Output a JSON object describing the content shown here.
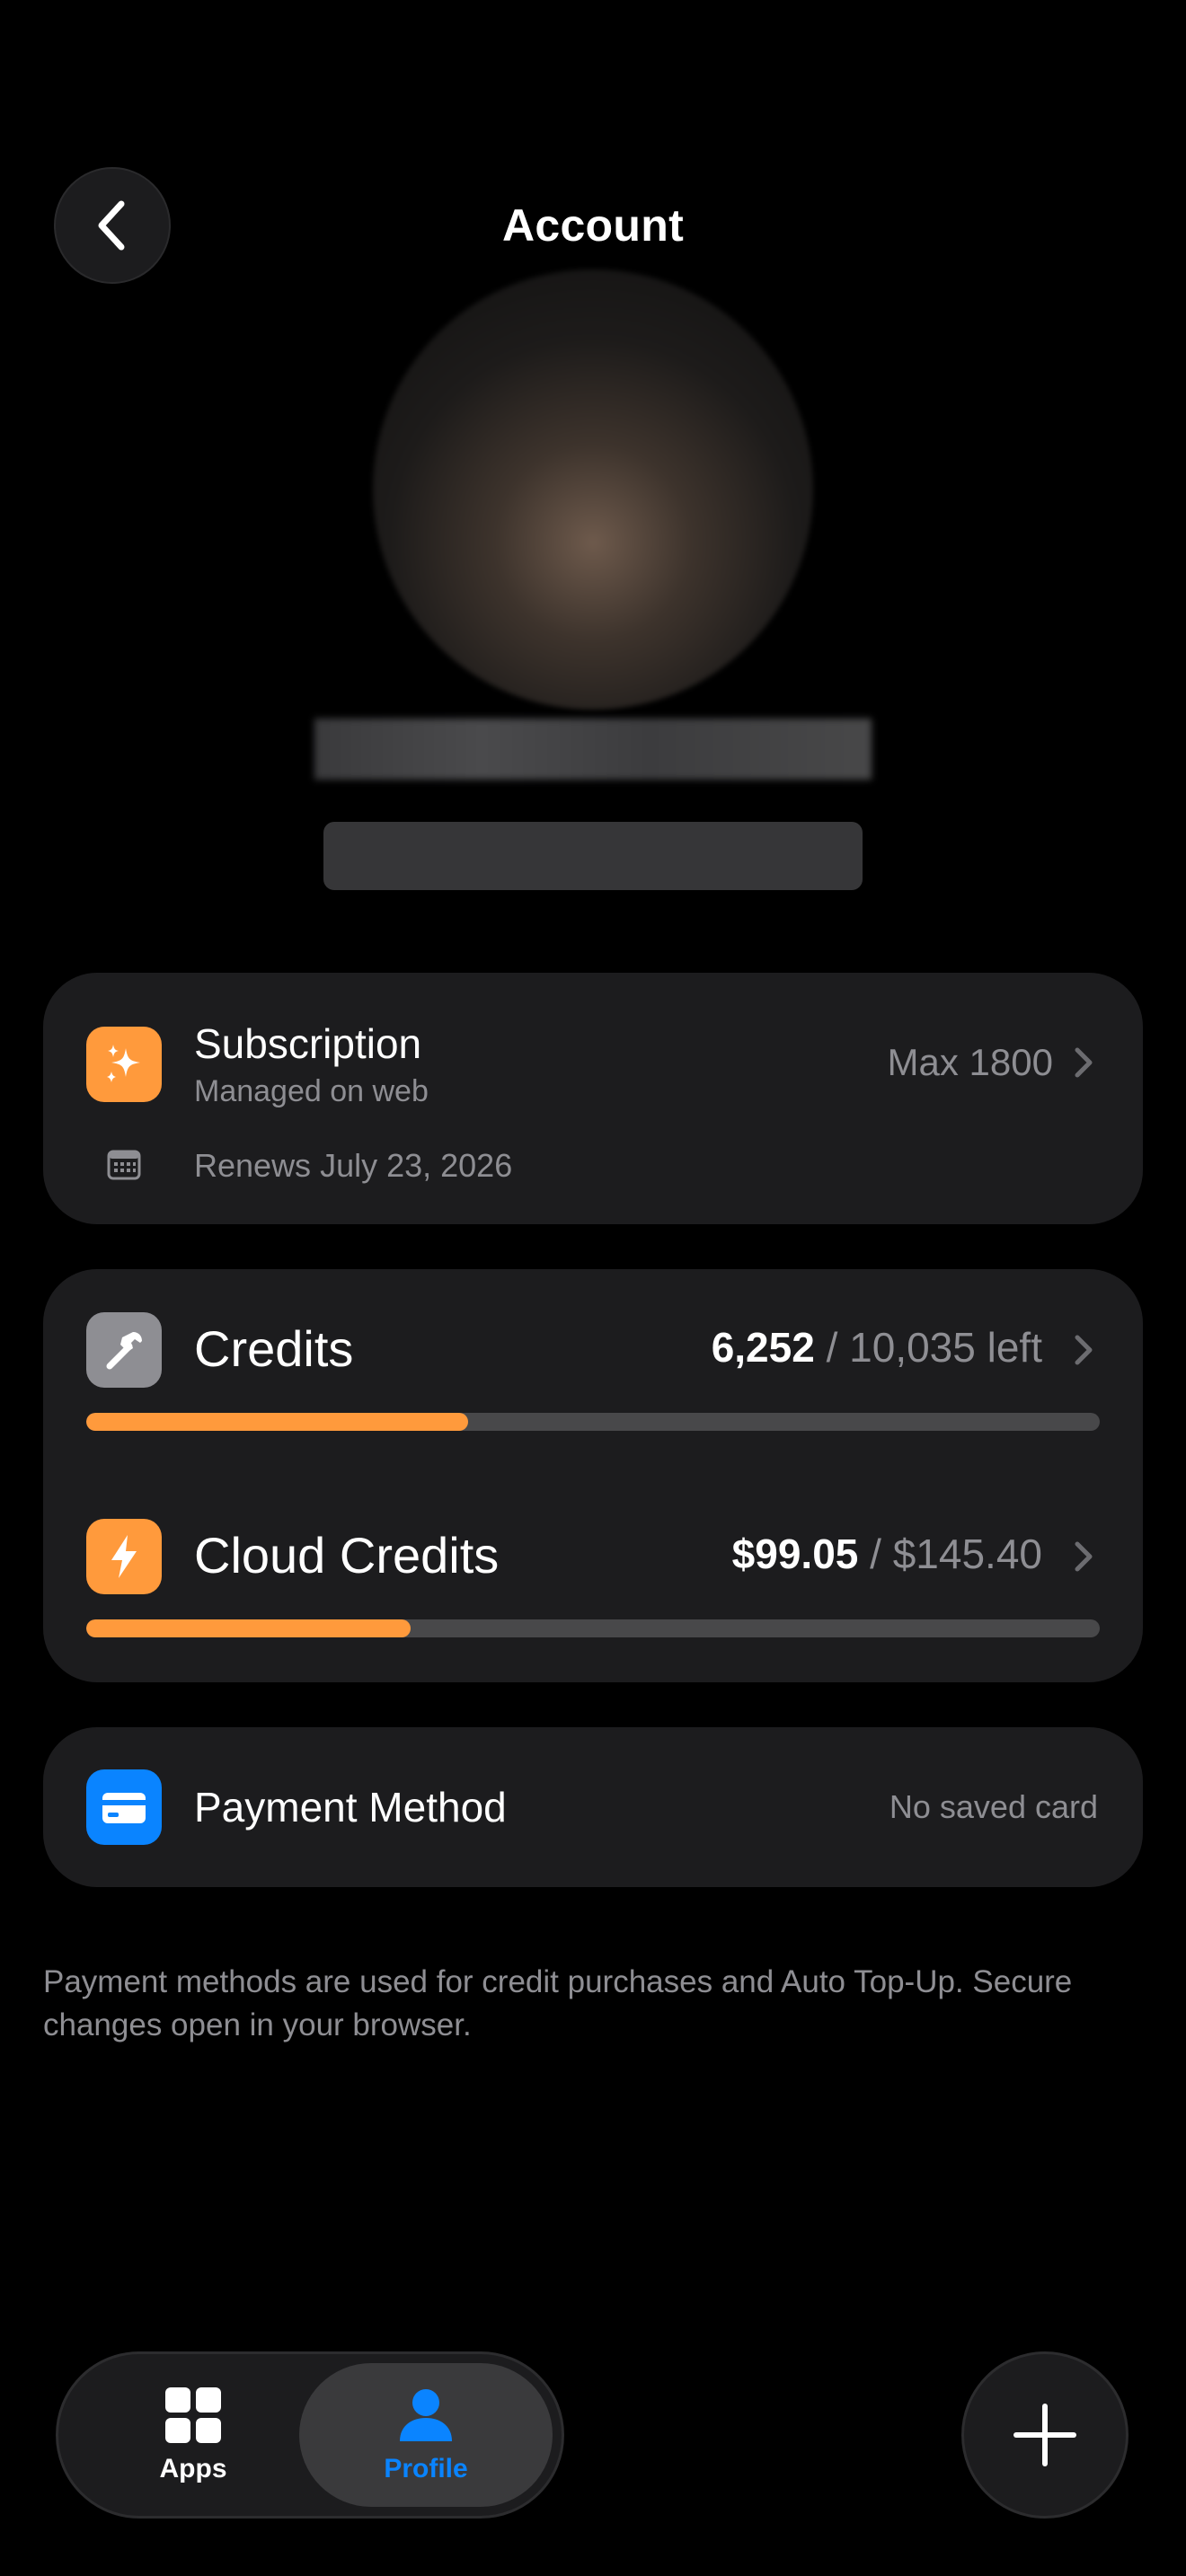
{
  "header": {
    "title": "Account",
    "back_icon": "chevron-left-icon"
  },
  "subscription": {
    "title": "Subscription",
    "subtitle": "Managed on web",
    "plan": "Max 1800",
    "renewal": "Renews July 23, 2026",
    "icon": "sparkles-icon",
    "calendar_icon": "calendar-icon"
  },
  "credits": {
    "title": "Credits",
    "used": "6,252",
    "separator": " / ",
    "total": "10,035 left",
    "progress": 0.377,
    "icon": "hammer-icon"
  },
  "cloud_credits": {
    "title": "Cloud Credits",
    "used": "$99.05",
    "separator": " / ",
    "total": "$145.40",
    "progress": 0.32,
    "icon": "lightning-bolt-icon"
  },
  "payment": {
    "title": "Payment Method",
    "value": "No saved card",
    "icon": "credit-card-icon"
  },
  "footnote": "Payment methods are used for credit purchases and Auto Top-Up. Secure changes open in your browser.",
  "tabbar": {
    "apps_label": "Apps",
    "profile_label": "Profile",
    "active": "Profile",
    "add_icon": "plus-icon"
  },
  "colors": {
    "accent_orange": "#ff9a3c",
    "accent_blue": "#0a84ff",
    "card_bg": "#1c1c1e",
    "secondary_text": "#8e8e93"
  }
}
